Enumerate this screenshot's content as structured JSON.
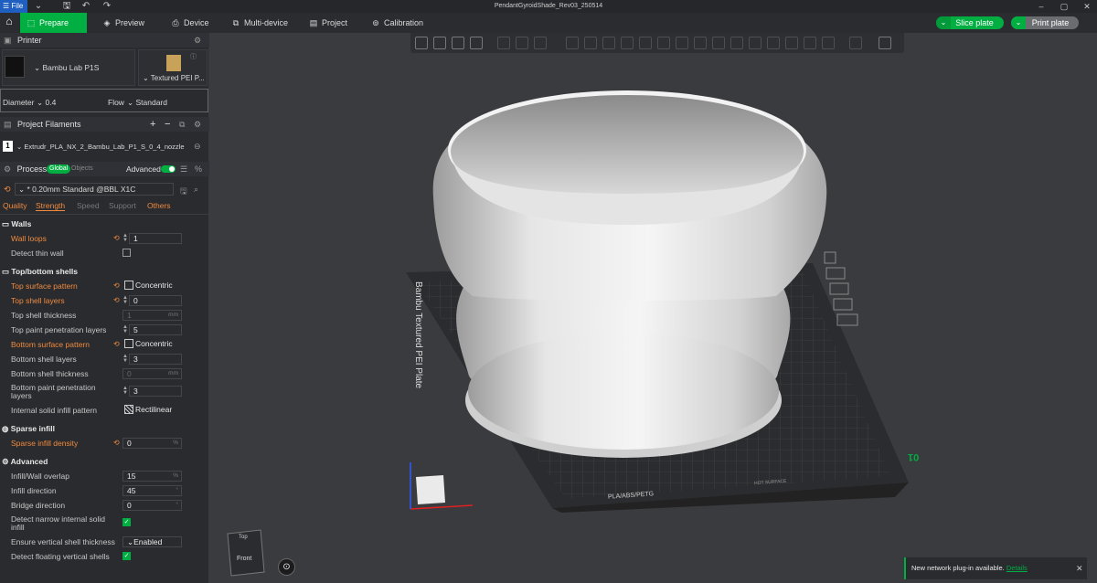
{
  "titlebar": {
    "file_label": "File",
    "title": "PendantGyroidShade_Rev03_250514"
  },
  "toolbar": {
    "tabs": [
      {
        "label": "Prepare"
      },
      {
        "label": "Preview"
      },
      {
        "label": "Device"
      },
      {
        "label": "Multi-device"
      },
      {
        "label": "Project"
      },
      {
        "label": "Calibration"
      }
    ],
    "slice_label": "Slice plate",
    "print_label": "Print plate",
    "accent": "#00ae42"
  },
  "printer": {
    "header": "Printer",
    "name": "Bambu Lab P1S",
    "plate": "Textured PEI P...",
    "diameter_label": "Diameter",
    "diameter_value": "0.4",
    "flow_label": "Flow",
    "flow_value": "Standard"
  },
  "filaments": {
    "header": "Project Filaments",
    "items": [
      {
        "index": "1",
        "name": "Extrudr_PLA_NX_2_Bambu_Lab_P1_S_0_4_nozzle"
      }
    ]
  },
  "process": {
    "header": "Process",
    "global_label": "Global",
    "objects_label": "Objects",
    "advanced_label": "Advanced",
    "preset": "* 0.20mm Standard @BBL X1C",
    "tabs": [
      "Quality",
      "Strength",
      "Speed",
      "Support",
      "Others"
    ]
  },
  "settings": {
    "walls": {
      "title": "Walls",
      "wall_loops_label": "Wall loops",
      "wall_loops_value": "1",
      "detect_thin_wall_label": "Detect thin wall"
    },
    "topbottom": {
      "title": "Top/bottom shells",
      "top_surface_pattern_label": "Top surface pattern",
      "top_surface_pattern_value": "Concentric",
      "top_shell_layers_label": "Top shell layers",
      "top_shell_layers_value": "0",
      "top_shell_thickness_label": "Top shell thickness",
      "top_shell_thickness_value": "1",
      "unit_mm": "mm",
      "top_paint_label": "Top paint penetration layers",
      "top_paint_value": "5",
      "bottom_surface_pattern_label": "Bottom surface pattern",
      "bottom_surface_pattern_value": "Concentric",
      "bottom_shell_layers_label": "Bottom shell layers",
      "bottom_shell_layers_value": "3",
      "bottom_shell_thickness_label": "Bottom shell thickness",
      "bottom_shell_thickness_value": "0",
      "bottom_paint_label_1": "Bottom paint penetration",
      "bottom_paint_label_2": "layers",
      "bottom_paint_value": "3",
      "internal_solid_label": "Internal solid infill pattern",
      "internal_solid_value": "Rectilinear"
    },
    "sparse": {
      "title": "Sparse infill",
      "density_label": "Sparse infill density",
      "density_value": "0",
      "unit_pct": "%"
    },
    "advanced": {
      "title": "Advanced",
      "overlap_label": "Infill/Wall overlap",
      "overlap_value": "15",
      "infill_dir_label": "Infill direction",
      "infill_dir_value": "45",
      "unit_deg": "°",
      "bridge_dir_label": "Bridge direction",
      "bridge_dir_value": "0",
      "narrow_label_1": "Detect narrow internal solid",
      "narrow_label_2": "infill",
      "ensure_label": "Ensure vertical shell thickness",
      "ensure_value": "Enabled",
      "floating_label": "Detect floating vertical shells"
    }
  },
  "viewport": {
    "plate_label": "Bambu Textured PEI Plate",
    "plate_number": "01",
    "plate_material": "PLA/ABS/PETG",
    "plate_hot": "HOT SURFACE",
    "cube_top": "Top",
    "cube_front": "Front",
    "notification": "New network plug-in available.",
    "notification_link": "Details"
  }
}
